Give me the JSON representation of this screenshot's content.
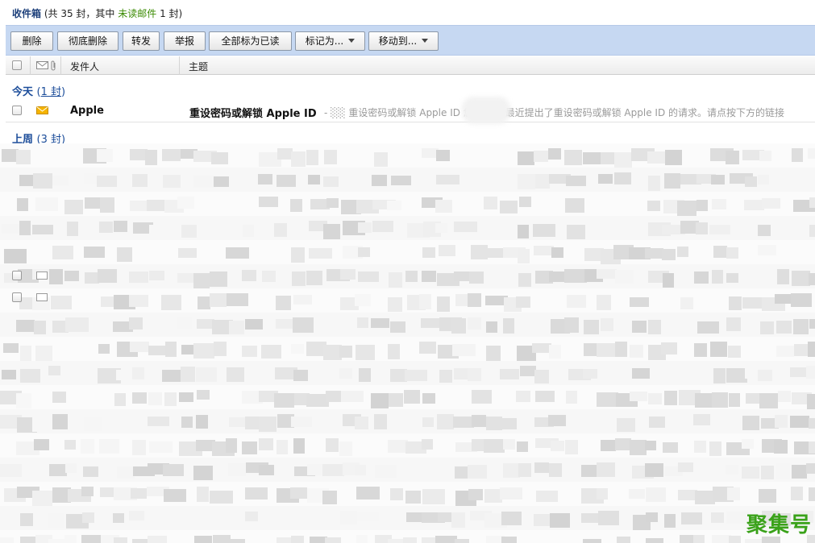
{
  "inbox": {
    "name": "收件箱",
    "summary_prefix": "(共 35 封，其中",
    "unread_label": "未读邮件",
    "summary_suffix": "1 封)"
  },
  "toolbar": {
    "delete": "删除",
    "delete_permanently": "彻底删除",
    "forward": "转发",
    "report": "举报",
    "mark_all_read": "全部标为已读",
    "mark_as": "标记为...",
    "move_to": "移动到..."
  },
  "columns": {
    "sender": "发件人",
    "subject": "主题"
  },
  "groups": [
    {
      "label": "今天",
      "count": "1 封"
    },
    {
      "label": "上周",
      "count": "3 封"
    }
  ],
  "messages": [
    {
      "sender": "Apple",
      "subject": "重设密码或解锁 Apple ID",
      "preview": "- ░░ 重设密码或解锁 Apple ID             您好：  您最近提出了重设密码或解锁 Apple ID 的请求。请点按下方的链接"
    }
  ],
  "watermark": "聚集号",
  "colors": {
    "toolbar_bg": "#c6d8f2",
    "link_blue": "#1c4d9a",
    "unread_green": "#3a8a00",
    "watermark_green": "#3aa21a",
    "unread_icon": "#f5b400"
  }
}
